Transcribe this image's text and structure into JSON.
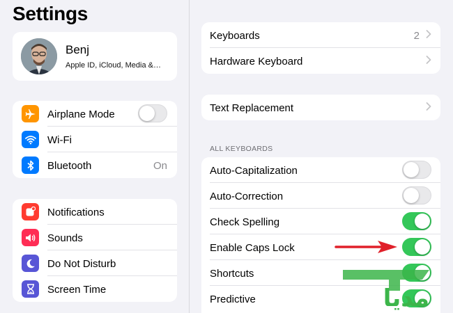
{
  "sidebar": {
    "title": "Settings",
    "profile": {
      "name": "Benj",
      "subtitle": "Apple ID, iCloud, Media &…"
    },
    "group1": [
      {
        "label": "Airplane Mode",
        "icon": "airplane-icon",
        "color": "#ff9500",
        "toggle": false
      },
      {
        "label": "Wi-Fi",
        "icon": "wifi-icon",
        "color": "#007aff"
      },
      {
        "label": "Bluetooth",
        "icon": "bluetooth-icon",
        "color": "#007aff",
        "value": "On"
      }
    ],
    "group2": [
      {
        "label": "Notifications",
        "icon": "notifications-icon",
        "color": "#ff3b30"
      },
      {
        "label": "Sounds",
        "icon": "sounds-icon",
        "color": "#ff2d55"
      },
      {
        "label": "Do Not Disturb",
        "icon": "moon-icon",
        "color": "#5856d6"
      },
      {
        "label": "Screen Time",
        "icon": "hourglass-icon",
        "color": "#5856d6"
      }
    ]
  },
  "main": {
    "keyboards_group": [
      {
        "label": "Keyboards",
        "value": "2"
      },
      {
        "label": "Hardware Keyboard"
      }
    ],
    "text_replacement": {
      "label": "Text Replacement"
    },
    "section_header": "ALL KEYBOARDS",
    "all_keyboards": [
      {
        "label": "Auto-Capitalization",
        "on": false
      },
      {
        "label": "Auto-Correction",
        "on": false
      },
      {
        "label": "Check Spelling",
        "on": true
      },
      {
        "label": "Enable Caps Lock",
        "on": true
      },
      {
        "label": "Shortcuts",
        "on": true
      },
      {
        "label": "Predictive",
        "on": true
      }
    ]
  },
  "colors": {
    "toggle_on": "#34c759",
    "toggle_off": "#e9e9eb",
    "arrow": "#e0202a",
    "watermark": "#3cb54a"
  },
  "watermark_text": "مدیا"
}
